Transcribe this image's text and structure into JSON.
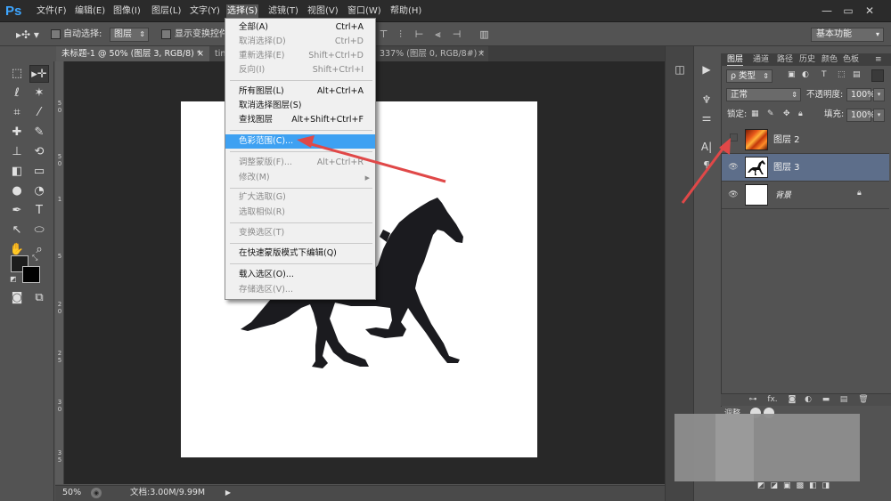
{
  "app": {
    "logo": "Ps"
  },
  "menubar": {
    "items": [
      "文件(F)",
      "编辑(E)",
      "图像(I)",
      "图层(L)",
      "文字(Y)",
      "选择(S)",
      "滤镜(T)",
      "视图(V)",
      "窗口(W)",
      "帮助(H)"
    ],
    "active_index": 5,
    "window_controls": [
      "—",
      "▭",
      "✕"
    ]
  },
  "options_bar": {
    "move_tool_icon": "move-tool-icon",
    "auto_select_label": "自动选择:",
    "auto_select_value": "图层",
    "show_transform_label": "显示变换控件"
  },
  "workspace": {
    "value": "基本功能"
  },
  "tabs": [
    {
      "label": "未标题-1 @ 50% (图层 3, RGB/8) *",
      "close": "×"
    },
    {
      "label": "tin",
      "close": ""
    },
    {
      "label": "337% (图层 0, RGB/8#) *",
      "close": "×"
    }
  ],
  "select_menu": {
    "items": [
      {
        "label": "全部(A)",
        "shortcut": "Ctrl+A",
        "disabled": false
      },
      {
        "label": "取消选择(D)",
        "shortcut": "Ctrl+D",
        "disabled": true
      },
      {
        "label": "重新选择(E)",
        "shortcut": "Shift+Ctrl+D",
        "disabled": true
      },
      {
        "label": "反向(I)",
        "shortcut": "Shift+Ctrl+I",
        "disabled": true
      },
      {
        "label": "所有图层(L)",
        "shortcut": "Alt+Ctrl+A",
        "disabled": false
      },
      {
        "label": "取消选择图层(S)",
        "shortcut": "",
        "disabled": false
      },
      {
        "label": "查找图层",
        "shortcut": "Alt+Shift+Ctrl+F",
        "disabled": false
      },
      {
        "label": "色彩范围(C)...",
        "shortcut": "",
        "disabled": false,
        "highlighted": true
      },
      {
        "label": "调整蒙版(F)...",
        "shortcut": "Alt+Ctrl+R",
        "disabled": true
      },
      {
        "label": "修改(M)",
        "shortcut": "",
        "disabled": true,
        "submenu": true
      },
      {
        "label": "扩大选取(G)",
        "shortcut": "",
        "disabled": true
      },
      {
        "label": "选取相似(R)",
        "shortcut": "",
        "disabled": true
      },
      {
        "label": "变换选区(T)",
        "shortcut": "",
        "disabled": true
      },
      {
        "label": "在快速蒙版模式下编辑(Q)",
        "shortcut": "",
        "disabled": false
      },
      {
        "label": "载入选区(O)...",
        "shortcut": "",
        "disabled": false
      },
      {
        "label": "存储选区(V)...",
        "shortcut": "",
        "disabled": true
      }
    ]
  },
  "status_bar": {
    "zoom": "50%",
    "doc_info": "文档:3.00M/9.99M"
  },
  "ruler_left_labels": [
    "5",
    "0",
    "5",
    "0",
    "1",
    "5",
    "2",
    "0",
    "2",
    "5",
    "3",
    "0",
    "3",
    "5"
  ],
  "layers_panel": {
    "tabs": [
      "图层",
      "通道",
      "路径",
      "历史",
      "颜色",
      "色板"
    ],
    "filter_kind": "ρ 类型",
    "blend_mode": "正常",
    "opacity_label": "不透明度:",
    "opacity_value": "100%",
    "lock_label": "锁定:",
    "fill_label": "填充:",
    "fill_value": "100%",
    "layers": [
      {
        "name": "图层 2",
        "visible": false,
        "selected": false,
        "thumb": "fire"
      },
      {
        "name": "图层 3",
        "visible": true,
        "selected": true,
        "thumb": "horse"
      },
      {
        "name": "背景",
        "visible": true,
        "selected": false,
        "thumb": "white",
        "locked": true
      }
    ],
    "bottom_icons": [
      "link-icon",
      "fx-icon",
      "mask-icon",
      "adjustment-icon",
      "folder-icon",
      "new-layer-icon",
      "trash-icon"
    ],
    "fx_label": "fx."
  },
  "adjustments_panel": {
    "label": "调整"
  },
  "colors": {
    "accent_highlight": "#3ea1f2",
    "annotation_arrow": "#e04848",
    "selected_layer": "#5d6e8a"
  }
}
